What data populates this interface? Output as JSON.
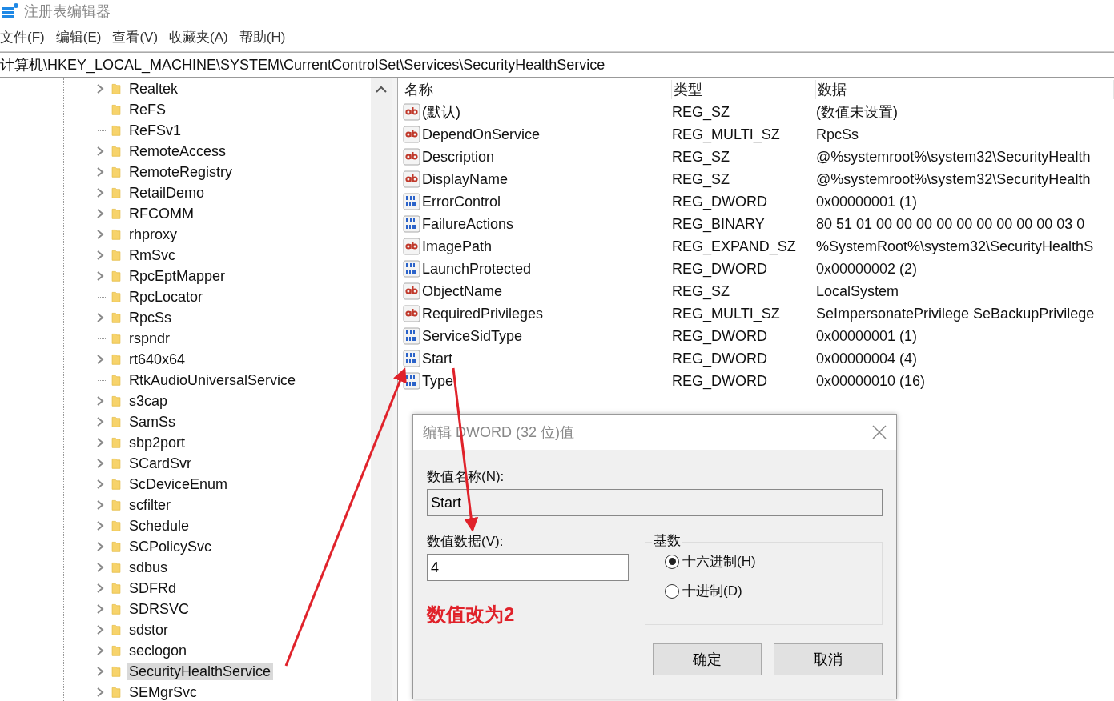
{
  "window": {
    "title": "注册表编辑器"
  },
  "menu": [
    "文件(F)",
    "编辑(E)",
    "查看(V)",
    "收藏夹(A)",
    "帮助(H)"
  ],
  "address": "计算机\\HKEY_LOCAL_MACHINE\\SYSTEM\\CurrentControlSet\\Services\\SecurityHealthService",
  "tree": [
    {
      "label": "Realtek",
      "has_children": true,
      "selected": false
    },
    {
      "label": "ReFS",
      "has_children": false,
      "selected": false
    },
    {
      "label": "ReFSv1",
      "has_children": false,
      "selected": false
    },
    {
      "label": "RemoteAccess",
      "has_children": true,
      "selected": false
    },
    {
      "label": "RemoteRegistry",
      "has_children": true,
      "selected": false
    },
    {
      "label": "RetailDemo",
      "has_children": true,
      "selected": false
    },
    {
      "label": "RFCOMM",
      "has_children": true,
      "selected": false
    },
    {
      "label": "rhproxy",
      "has_children": true,
      "selected": false
    },
    {
      "label": "RmSvc",
      "has_children": true,
      "selected": false
    },
    {
      "label": "RpcEptMapper",
      "has_children": true,
      "selected": false
    },
    {
      "label": "RpcLocator",
      "has_children": false,
      "selected": false
    },
    {
      "label": "RpcSs",
      "has_children": true,
      "selected": false
    },
    {
      "label": "rspndr",
      "has_children": false,
      "selected": false
    },
    {
      "label": "rt640x64",
      "has_children": true,
      "selected": false
    },
    {
      "label": "RtkAudioUniversalService",
      "has_children": false,
      "selected": false
    },
    {
      "label": "s3cap",
      "has_children": true,
      "selected": false
    },
    {
      "label": "SamSs",
      "has_children": true,
      "selected": false
    },
    {
      "label": "sbp2port",
      "has_children": true,
      "selected": false
    },
    {
      "label": "SCardSvr",
      "has_children": true,
      "selected": false
    },
    {
      "label": "ScDeviceEnum",
      "has_children": true,
      "selected": false
    },
    {
      "label": "scfilter",
      "has_children": true,
      "selected": false
    },
    {
      "label": "Schedule",
      "has_children": true,
      "selected": false
    },
    {
      "label": "SCPolicySvc",
      "has_children": true,
      "selected": false
    },
    {
      "label": "sdbus",
      "has_children": true,
      "selected": false
    },
    {
      "label": "SDFRd",
      "has_children": true,
      "selected": false
    },
    {
      "label": "SDRSVC",
      "has_children": true,
      "selected": false
    },
    {
      "label": "sdstor",
      "has_children": true,
      "selected": false
    },
    {
      "label": "seclogon",
      "has_children": true,
      "selected": false
    },
    {
      "label": "SecurityHealthService",
      "has_children": true,
      "selected": true
    },
    {
      "label": "SEMgrSvc",
      "has_children": true,
      "selected": false
    }
  ],
  "table": {
    "columns": [
      "名称",
      "类型",
      "数据"
    ],
    "rows": [
      {
        "kind": "string",
        "name": "(默认)",
        "type": "REG_SZ",
        "data": "(数值未设置)"
      },
      {
        "kind": "string",
        "name": "DependOnService",
        "type": "REG_MULTI_SZ",
        "data": "RpcSs"
      },
      {
        "kind": "string",
        "name": "Description",
        "type": "REG_SZ",
        "data": "@%systemroot%\\system32\\SecurityHealth"
      },
      {
        "kind": "string",
        "name": "DisplayName",
        "type": "REG_SZ",
        "data": "@%systemroot%\\system32\\SecurityHealth"
      },
      {
        "kind": "binary",
        "name": "ErrorControl",
        "type": "REG_DWORD",
        "data": "0x00000001 (1)"
      },
      {
        "kind": "binary",
        "name": "FailureActions",
        "type": "REG_BINARY",
        "data": "80 51 01 00 00 00 00 00 00 00 00 00 03 0"
      },
      {
        "kind": "string",
        "name": "ImagePath",
        "type": "REG_EXPAND_SZ",
        "data": "%SystemRoot%\\system32\\SecurityHealthS"
      },
      {
        "kind": "binary",
        "name": "LaunchProtected",
        "type": "REG_DWORD",
        "data": "0x00000002 (2)"
      },
      {
        "kind": "string",
        "name": "ObjectName",
        "type": "REG_SZ",
        "data": "LocalSystem"
      },
      {
        "kind": "string",
        "name": "RequiredPrivileges",
        "type": "REG_MULTI_SZ",
        "data": "SeImpersonatePrivilege SeBackupPrivilege"
      },
      {
        "kind": "binary",
        "name": "ServiceSidType",
        "type": "REG_DWORD",
        "data": "0x00000001 (1)"
      },
      {
        "kind": "binary",
        "name": "Start",
        "type": "REG_DWORD",
        "data": "0x00000004 (4)"
      },
      {
        "kind": "binary",
        "name": "Type",
        "type": "REG_DWORD",
        "data": "0x00000010 (16)"
      }
    ]
  },
  "dialog": {
    "title": "编辑 DWORD (32 位)值",
    "name_label": "数值名称(N):",
    "name_value": "Start",
    "data_label": "数值数据(V):",
    "data_value": "4",
    "base_label": "基数",
    "bases": [
      {
        "label": "十六进制(H)",
        "selected": true
      },
      {
        "label": "十进制(D)",
        "selected": false
      }
    ],
    "buttons": [
      "确定",
      "取消"
    ]
  },
  "annotation": "数值改为2"
}
